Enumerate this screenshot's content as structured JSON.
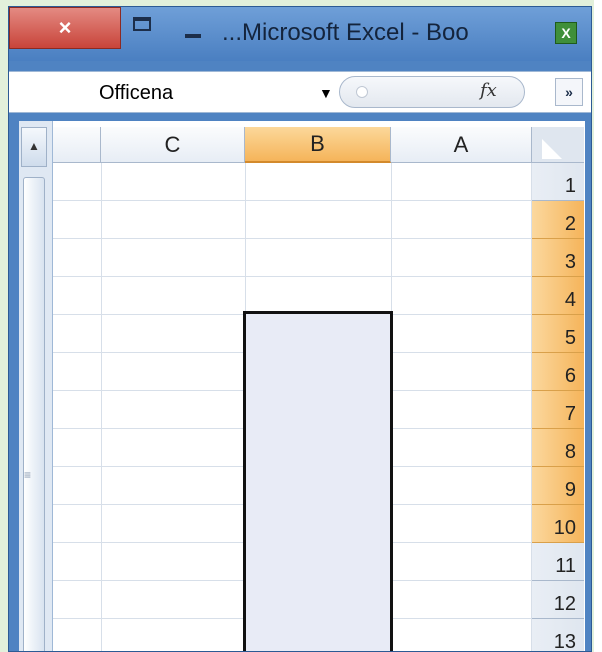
{
  "window": {
    "title": "...Microsoft Excel - Boo",
    "close_glyph": "×"
  },
  "formula_bar": {
    "font_name": "Officena",
    "fx_label": "fx",
    "expand_glyph": "»"
  },
  "sheet": {
    "columns": [
      "C",
      "B",
      "A"
    ],
    "selected_column": "B",
    "rows": [
      "1",
      "2",
      "3",
      "4",
      "5",
      "6",
      "7",
      "8",
      "9",
      "10",
      "11",
      "12",
      "13"
    ],
    "selected_rows": [
      "2",
      "3",
      "4",
      "5",
      "6",
      "7",
      "8",
      "9",
      "10"
    ],
    "selection_range_rows": [
      2,
      10
    ],
    "colors": {
      "selection_header": "#f5b45a",
      "selection_fill": "#e8ebf6",
      "window_frame": "#4f83c2"
    }
  },
  "icons": {
    "close": "close-icon",
    "maximize": "maximize-icon",
    "minimize": "minimize-icon",
    "excel": "excel-logo-icon"
  }
}
